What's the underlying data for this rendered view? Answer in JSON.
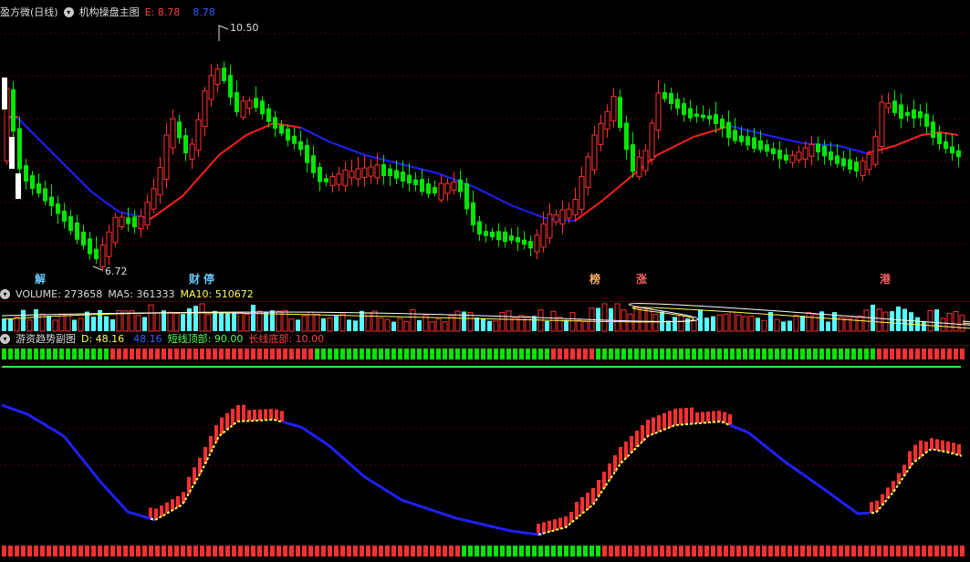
{
  "main": {
    "stock_name": "盈方微(日线)",
    "indicator_name": "机构操盘主图",
    "e_label": "E: 8.78",
    "value_label": "8.78",
    "high_label": "10.50",
    "low_label": "6.72",
    "markers": [
      "解",
      "财",
      "停",
      "榜",
      "涨",
      "港"
    ]
  },
  "volume": {
    "label": "VOLUME: 273658",
    "ma5": "MA5: 361333",
    "ma10": "MA10: 510672"
  },
  "sub": {
    "title": "游资趋势副图",
    "d_label": "D: 48.16",
    "d_value": "48.16",
    "short_top": "短线顶部: 90.00",
    "long_bottom": "长线底部: 10.00"
  },
  "colors": {
    "up": "#ff3030",
    "down": "#00e600",
    "ma_blue": "#2020ff",
    "ma_red": "#ff2020",
    "vol_up": "#ff3030",
    "vol_down": "#55ffff"
  }
}
